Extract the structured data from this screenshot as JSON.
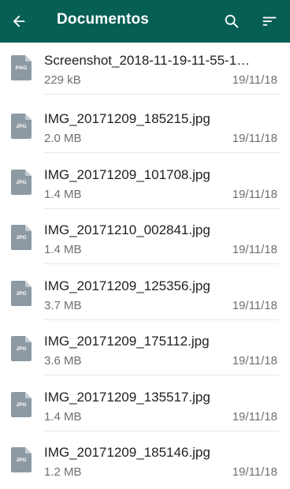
{
  "appbar": {
    "title": "Documentos",
    "back_icon": "arrow-left-icon",
    "search_icon": "search-icon",
    "sort_icon": "sort-icon",
    "color": "#075e54"
  },
  "files": [
    {
      "name": "Screenshot_2018-11-19-11-55-1…",
      "size": "229 kB",
      "date": "19/11/18",
      "type": "PNG"
    },
    {
      "name": "IMG_20171209_185215.jpg",
      "size": "2.0 MB",
      "date": "19/11/18",
      "type": "JPG"
    },
    {
      "name": "IMG_20171209_101708.jpg",
      "size": "1.4 MB",
      "date": "19/11/18",
      "type": "JPG"
    },
    {
      "name": "IMG_20171210_002841.jpg",
      "size": "1.4 MB",
      "date": "19/11/18",
      "type": "JPG"
    },
    {
      "name": "IMG_20171209_125356.jpg",
      "size": "3.7 MB",
      "date": "19/11/18",
      "type": "JPG"
    },
    {
      "name": "IMG_20171209_175112.jpg",
      "size": "3.6 MB",
      "date": "19/11/18",
      "type": "JPG"
    },
    {
      "name": "IMG_20171209_135517.jpg",
      "size": "1.4 MB",
      "date": "19/11/18",
      "type": "JPG"
    },
    {
      "name": "IMG_20171209_185146.jpg",
      "size": "1.2 MB",
      "date": "19/11/18",
      "type": "JPG"
    }
  ]
}
